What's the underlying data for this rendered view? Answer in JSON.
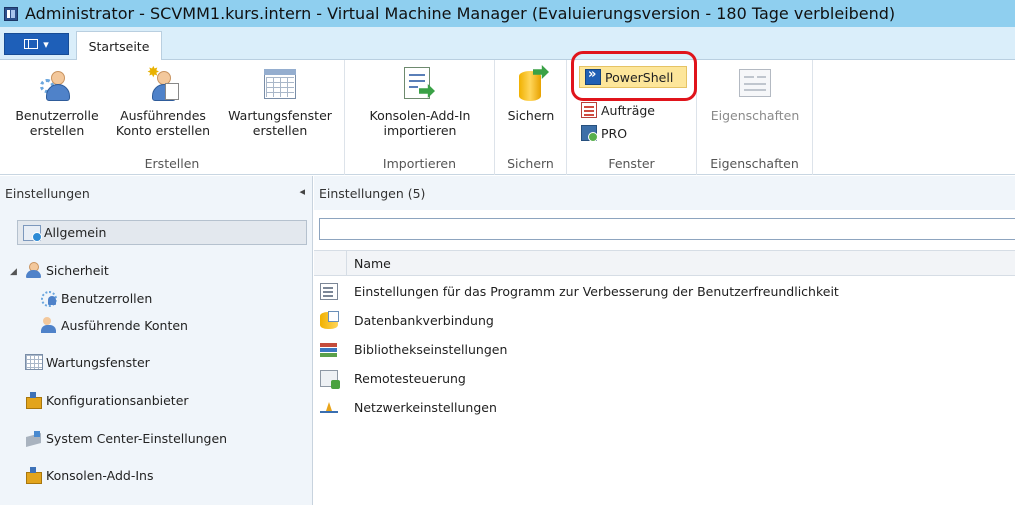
{
  "window": {
    "title": "Administrator - SCVMM1.kurs.intern - Virtual Machine Manager (Evaluierungsversion - 180 Tage verbleibend)"
  },
  "tabs": {
    "file_glyph": "▾",
    "start": "Startseite"
  },
  "ribbon": {
    "groups": {
      "create": "Erstellen",
      "import": "Importieren",
      "backup": "Sichern",
      "window": "Fenster",
      "properties": "Eigenschaften"
    },
    "buttons": {
      "create_user_role_1": "Benutzerrolle",
      "create_user_role_2": "erstellen",
      "create_runas_1": "Ausführendes",
      "create_runas_2": "Konto erstellen",
      "create_maint_1": "Wartungsfenster",
      "create_maint_2": "erstellen",
      "import_addin_1": "Konsolen-Add-In",
      "import_addin_2": "importieren",
      "backup": "Sichern",
      "powershell": "PowerShell",
      "jobs": "Aufträge",
      "pro": "PRO",
      "properties": "Eigenschaften"
    }
  },
  "left_pane": {
    "title": "Einstellungen",
    "collapse_glyph": "◂",
    "items": {
      "general": "Allgemein",
      "security": "Sicherheit",
      "user_roles": "Benutzerrollen",
      "runas_accounts": "Ausführende Konten",
      "maintenance": "Wartungsfenster",
      "config_providers": "Konfigurationsanbieter",
      "sc_settings": "System Center-Einstellungen",
      "console_addins": "Konsolen-Add-Ins"
    },
    "expand_glyph": "◢"
  },
  "main_pane": {
    "title": "Einstellungen (5)",
    "search_value": "",
    "column_name": "Name",
    "rows": [
      "Einstellungen für das Programm zur Verbesserung der Benutzerfreundlichkeit",
      "Datenbankverbindung",
      "Bibliothekseinstellungen",
      "Remotesteuerung",
      "Netzwerkeinstellungen"
    ]
  },
  "colors": {
    "titlebar": "#8fcfef",
    "file_button": "#1e5fb8",
    "highlight": "#e0141b",
    "powershell_bg": "#fde69a"
  }
}
